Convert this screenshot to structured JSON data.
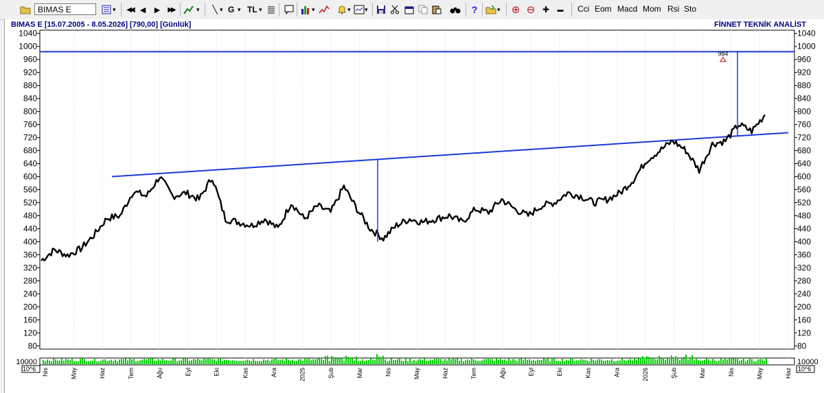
{
  "toolbar": {
    "symbol": "BIMAS E",
    "text_buttons": [
      "Cci",
      "Eom",
      "Macd",
      "Mom",
      "Rsi",
      "Sto"
    ],
    "glyphs": {
      "first": "◀◀",
      "prev": "◀",
      "next": "▶",
      "last": "▶▶",
      "line": "╲",
      "g": "G",
      "tl": "TL",
      "help": "?",
      "zoom_in": "⊕",
      "zoom_out": "⊖",
      "plus": "✚",
      "minus": "▬"
    }
  },
  "header": {
    "title": "BIMAS E  [15.07.2005 - 8.05.2026]  [790,00]  [Günlük]",
    "brand": "FİNNET TEKNİK ANALİST"
  },
  "chart_data": {
    "type": "line",
    "symbol": "BIMAS E",
    "ylim": [
      70,
      1050
    ],
    "y_ticks": [
      80,
      120,
      160,
      200,
      240,
      280,
      320,
      360,
      400,
      440,
      480,
      520,
      560,
      600,
      640,
      680,
      720,
      760,
      800,
      840,
      880,
      920,
      960,
      1000,
      1040
    ],
    "x_labels": [
      "Nis",
      "May",
      "Haz",
      "Tem",
      "Ağu",
      "Eyl",
      "Eki",
      "Kas",
      "Ara",
      "2025",
      "Şub",
      "Mar",
      "Nis",
      "May",
      "Haz",
      "Tem",
      "Ağu",
      "Eyl",
      "Eki",
      "Kas",
      "Ara",
      "2026",
      "Şub",
      "Mar",
      "Nis",
      "May",
      "Haz"
    ],
    "price_series": [
      342,
      375,
      358,
      378,
      420,
      472,
      480,
      555,
      540,
      600,
      540,
      550,
      530,
      598,
      470,
      460,
      450,
      470,
      440,
      520,
      470,
      510,
      490,
      570,
      500,
      440,
      410,
      450,
      470,
      460,
      470,
      480,
      460,
      500,
      490,
      530,
      500,
      480,
      510,
      520,
      550,
      540,
      520,
      530,
      550,
      590,
      650,
      680,
      710,
      680,
      620,
      700,
      710,
      760,
      740,
      790
    ],
    "horizontal_line": {
      "value": 984
    },
    "trend_line": {
      "from": 600,
      "to": 735
    },
    "spikes": [
      {
        "base": 652,
        "low": 400
      },
      {
        "base": 725,
        "high": 984
      }
    ],
    "annotation": {
      "label": "984",
      "value": 960
    },
    "volume": {
      "label": "10000",
      "unit": "10^6",
      "color": "#00cc00"
    },
    "grid": "vertical-dotted",
    "legend": "none"
  }
}
